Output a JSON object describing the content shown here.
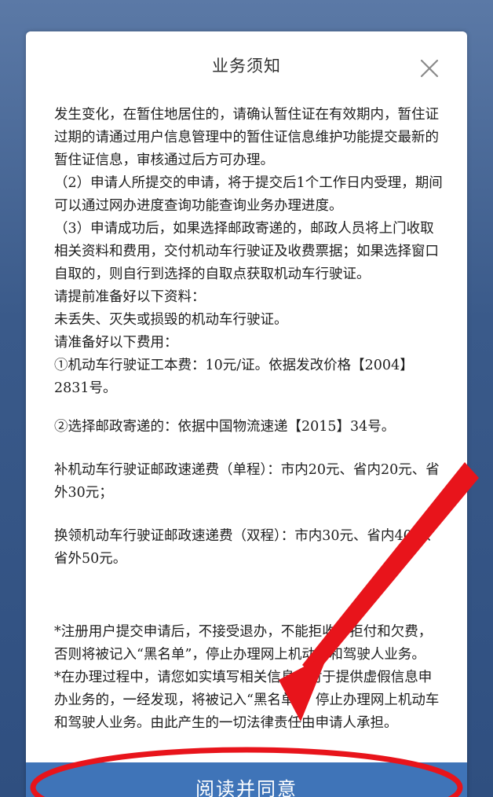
{
  "dialog": {
    "title": "业务须知",
    "close_icon": "close-icon",
    "agree_label": "阅读并同意",
    "agree_color": "#3f74b8"
  },
  "notice": {
    "p1": "发生变化，在暂住地居住的，请确认暂住证在有效期内，暂住证过期的请通过用户信息管理中的暂住证信息维护功能提交最新的暂住证信息，审核通过后方可办理。",
    "p2": "（2）申请人所提交的申请，将于提交后1个工作日内受理，期间可以通过网办进度查询功能查询业务办理进度。",
    "p3": "（3）申请成功后，如果选择邮政寄递的，邮政人员将上门收取相关资料和费用，交付机动车行驶证及收费票据；如果选择窗口自取的，则自行到选择的自取点获取机动车行驶证。",
    "p4": "请提前准备好以下资料：",
    "p5": "未丢失、灭失或损毁的机动车行驶证。",
    "p6": "请准备好以下费用：",
    "p7": "①机动车行驶证工本费：10元/证。依据发改价格【2004】2831号。",
    "p8": "②选择邮政寄递的：依据中国物流速递【2015】34号。",
    "p9": "补机动车行驶证邮政速递费（单程）：市内20元、省内20元、省外30元；",
    "p10": "换领机动车行驶证邮政速递费（双程）：市内30元、省内40元、省外50元。",
    "p11": "*注册用户提交申请后，不接受退办，不能拒收、拒付和欠费，否则将被记入“黑名单”，停止办理网上机动车和驾驶人业务。",
    "p12": "*在办理过程中，请您如实填写相关信息，对于提供虚假信息申办业务的，一经发现，将被记入“黑名单”，停止办理网上机动车和驾驶人业务。由此产生的一切法律责任由申请人承担。"
  },
  "annotation": {
    "arrow_color": "#e8141b",
    "icon": "red-arrow-icon",
    "highlight": "red-ellipse-highlight"
  }
}
